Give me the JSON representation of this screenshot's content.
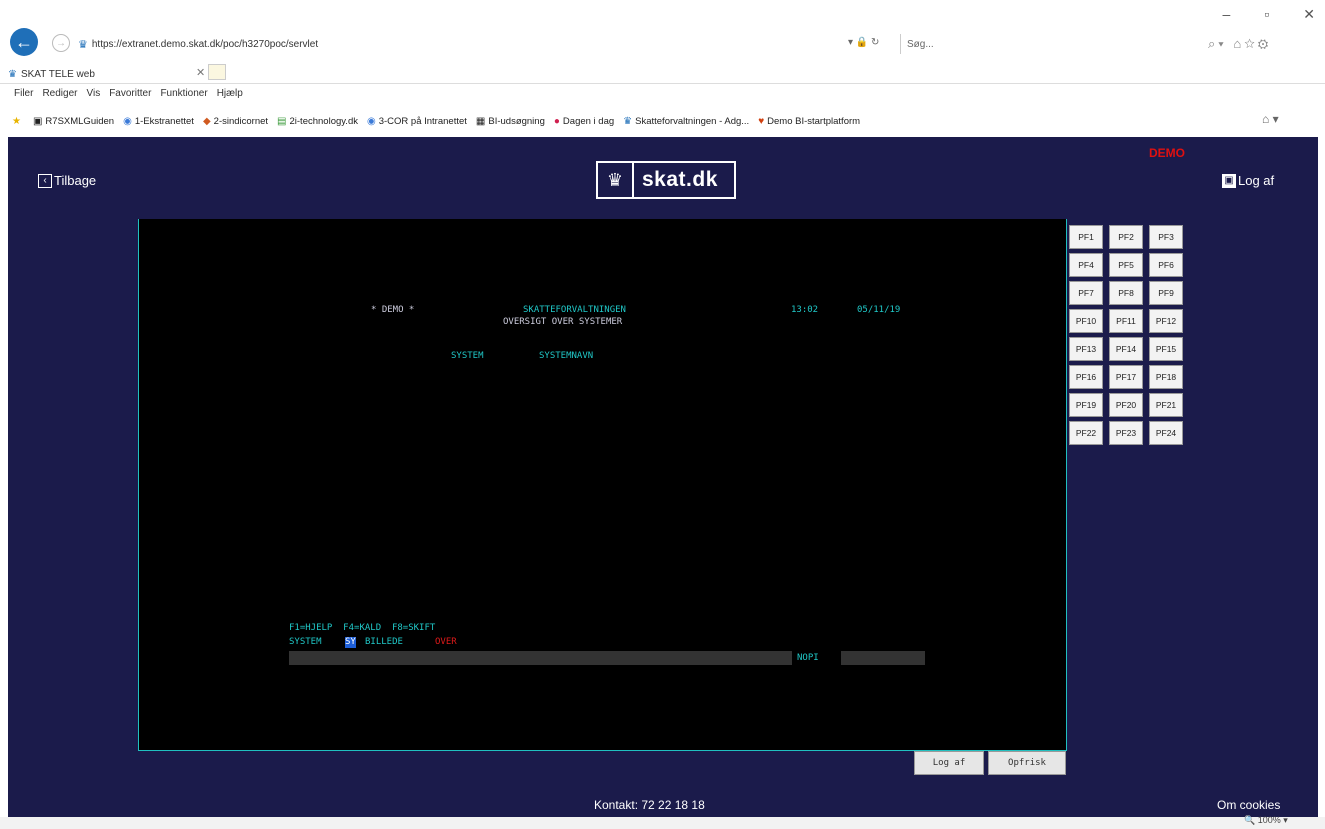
{
  "browser": {
    "address": "https://extranet.demo.skat.dk/poc/h3270poc/servlet",
    "search_placeholder": "Søg...",
    "tab_title": "SKAT TELE web",
    "menu": [
      "Filer",
      "Rediger",
      "Vis",
      "Favoritter",
      "Funktioner",
      "Hjælp"
    ],
    "favorites": [
      "R7SXMLGuiden",
      "1-Ekstranettet",
      "2-sindicornet",
      "2i-technology.dk",
      "3-COR på Intranettet",
      "BI-udsøgning",
      "Dagen i dag",
      "Skatteforvaltningen - Adg...",
      "Demo BI-startplatform"
    ],
    "zoom": "100%"
  },
  "header": {
    "back_label": "Tilbage",
    "logo_text": "skat.dk",
    "demo_label": "DEMO",
    "logout_label": "Log af"
  },
  "terminal": {
    "line_demo": "* DEMO *",
    "line_agency": "SKATTEFORVALTNINGEN",
    "line_time": "13:02",
    "line_date": "05/11/19",
    "line_subtitle": "OVERSIGT OVER SYSTEMER",
    "col_system": "SYSTEM",
    "col_systemnavn": "SYSTEMNAVN",
    "fkeys": "F1=HJELP  F4=KALD  F8=SKIFT",
    "prompt_system": "SYSTEM",
    "prompt_system_value": "SY",
    "prompt_billede": "BILLEDE",
    "prompt_billede_value": "OVER",
    "nopi_label": "NOPI"
  },
  "pf_keys": [
    "PF1",
    "PF2",
    "PF3",
    "PF4",
    "PF5",
    "PF6",
    "PF7",
    "PF8",
    "PF9",
    "PF10",
    "PF11",
    "PF12",
    "PF13",
    "PF14",
    "PF15",
    "PF16",
    "PF17",
    "PF18",
    "PF19",
    "PF20",
    "PF21",
    "PF22",
    "PF23",
    "PF24"
  ],
  "buttons": {
    "logaf": "Log af",
    "opfrisk": "Opfrisk"
  },
  "footer": {
    "contact": "Kontakt: 72 22 18 18",
    "cookies": "Om cookies"
  }
}
